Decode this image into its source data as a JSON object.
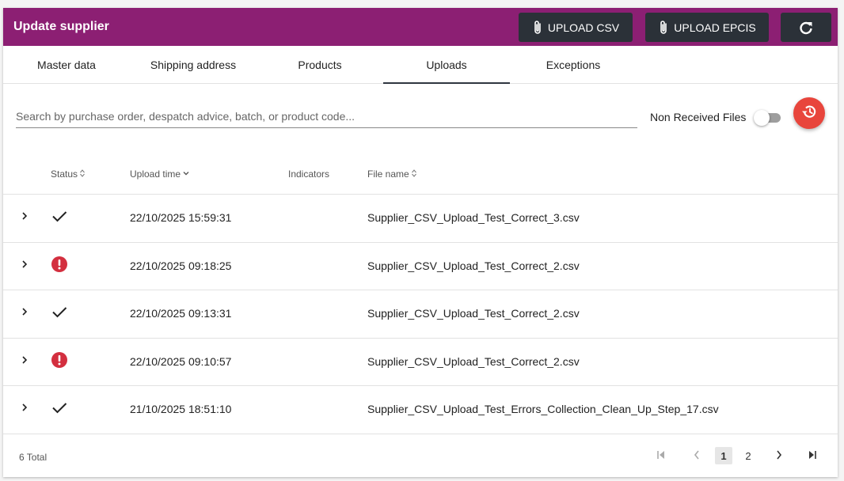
{
  "colors": {
    "header_bg": "#8c1f73",
    "button_bg": "#2b3138",
    "fab_bg": "#e8453c",
    "error_red": "#d32f3f"
  },
  "header": {
    "title": "Update supplier",
    "upload_csv_label": "UPLOAD CSV",
    "upload_epcis_label": "UPLOAD EPCIS",
    "upload_icon": "paperclip-icon",
    "refresh_icon": "refresh-icon"
  },
  "tabs": [
    {
      "label": "Master data"
    },
    {
      "label": "Shipping address"
    },
    {
      "label": "Products"
    },
    {
      "label": "Uploads",
      "active": true
    },
    {
      "label": "Exceptions"
    }
  ],
  "search": {
    "placeholder": "Search by purchase order, despatch advice, batch, or product code...",
    "value": ""
  },
  "toggle": {
    "label": "Non Received Files",
    "on": false
  },
  "fab_icon": "history-icon",
  "table": {
    "columns": [
      {
        "label": "Status",
        "sort": "unsorted"
      },
      {
        "label": "Upload time",
        "sort": "descending"
      },
      {
        "label": "Indicators"
      },
      {
        "label": "File name",
        "sort": "unsorted"
      }
    ],
    "rows": [
      {
        "status": "success",
        "upload_time": "22/10/2025 15:59:31",
        "indicators": "",
        "file_name": "Supplier_CSV_Upload_Test_Correct_3.csv"
      },
      {
        "status": "error",
        "upload_time": "22/10/2025 09:18:25",
        "indicators": "",
        "file_name": "Supplier_CSV_Upload_Test_Correct_2.csv"
      },
      {
        "status": "success",
        "upload_time": "22/10/2025 09:13:31",
        "indicators": "",
        "file_name": "Supplier_CSV_Upload_Test_Correct_2.csv"
      },
      {
        "status": "error",
        "upload_time": "22/10/2025 09:10:57",
        "indicators": "",
        "file_name": "Supplier_CSV_Upload_Test_Correct_2.csv"
      },
      {
        "status": "success",
        "upload_time": "21/10/2025 18:51:10",
        "indicators": "",
        "file_name": "Supplier_CSV_Upload_Test_Errors_Collection_Clean_Up_Step_17.csv"
      }
    ]
  },
  "footer": {
    "total": "6 Total",
    "pages": [
      "1",
      "2"
    ],
    "current_page": "1"
  }
}
